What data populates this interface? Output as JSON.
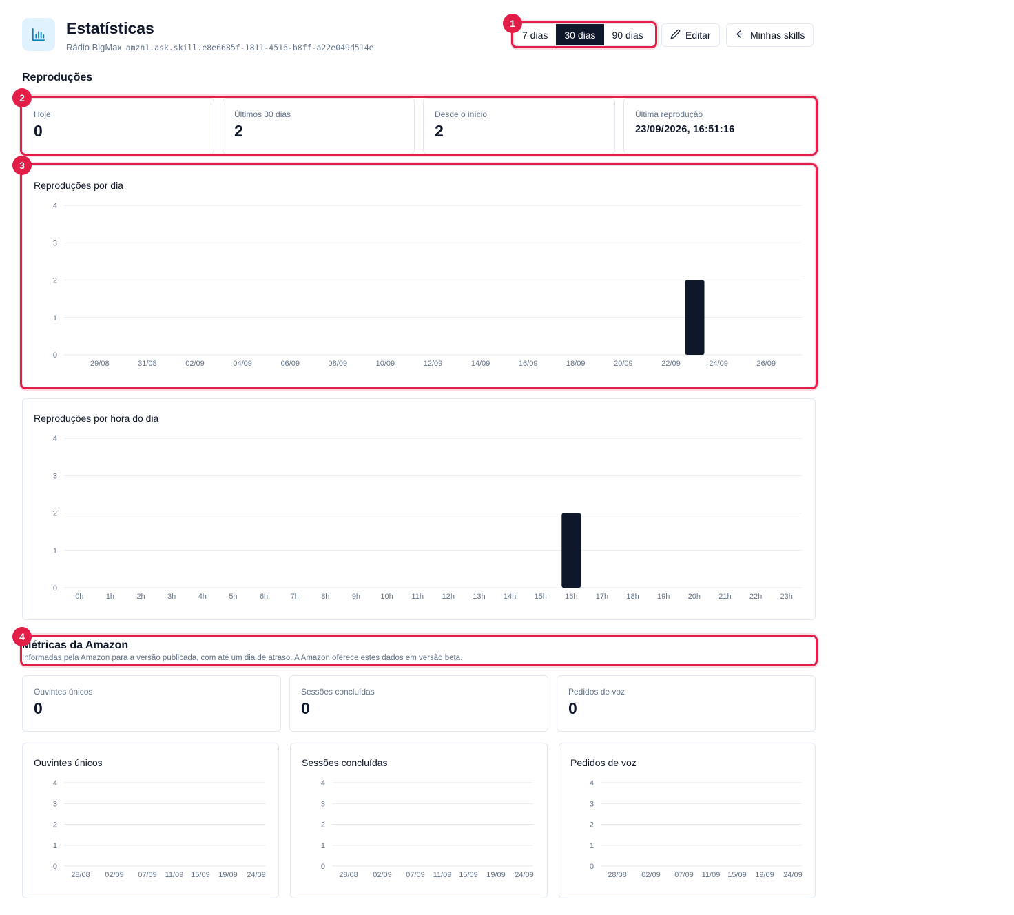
{
  "header": {
    "title": "Estatísticas",
    "skill_name": "Rádio BigMax",
    "skill_id": "amzn1.ask.skill.e8e6685f-1811-4516-b8ff-a22e049d514e",
    "ranges": [
      "7 dias",
      "30 dias",
      "90 dias"
    ],
    "active_range": "30 dias",
    "edit_label": "Editar",
    "back_label": "Minhas skills",
    "logo_icon": "bar-chart-icon"
  },
  "reproducoes": {
    "title": "Reproduções",
    "stats": [
      {
        "label": "Hoje",
        "value": "0"
      },
      {
        "label": "Últimos 30 dias",
        "value": "2"
      },
      {
        "label": "Desde o início",
        "value": "2"
      },
      {
        "label": "Última reprodução",
        "value": "23/09/2026, 16:51:16"
      }
    ]
  },
  "amazon": {
    "title": "Métricas da Amazon",
    "description": "Informadas pela Amazon para a versão publicada, com até um dia de atraso. A Amazon oferece estes dados em versão beta.",
    "stats": [
      {
        "label": "Ouvintes únicos",
        "value": "0"
      },
      {
        "label": "Sessões concluídas",
        "value": "0"
      },
      {
        "label": "Pedidos de voz",
        "value": "0"
      }
    ]
  },
  "annotations": [
    "1",
    "2",
    "3",
    "4"
  ],
  "colors": {
    "bar": "#0f172a",
    "highlight": "#e11d48",
    "grid": "#e5e7eb"
  },
  "chart_data": [
    {
      "type": "bar",
      "title": "Reproduções por dia",
      "x_ticks": [
        "29/08",
        "31/08",
        "02/09",
        "04/09",
        "06/09",
        "08/09",
        "10/09",
        "12/09",
        "14/09",
        "16/09",
        "18/09",
        "20/09",
        "22/09",
        "24/09",
        "26/09"
      ],
      "categories": [
        "28/08",
        "29/08",
        "30/08",
        "31/08",
        "01/09",
        "02/09",
        "03/09",
        "04/09",
        "05/09",
        "06/09",
        "07/09",
        "08/09",
        "09/09",
        "10/09",
        "11/09",
        "12/09",
        "13/09",
        "14/09",
        "15/09",
        "16/09",
        "17/09",
        "18/09",
        "19/09",
        "20/09",
        "21/09",
        "22/09",
        "23/09",
        "24/09",
        "25/09",
        "26/09",
        "27/09"
      ],
      "values": [
        0,
        0,
        0,
        0,
        0,
        0,
        0,
        0,
        0,
        0,
        0,
        0,
        0,
        0,
        0,
        0,
        0,
        0,
        0,
        0,
        0,
        0,
        0,
        0,
        0,
        0,
        2,
        0,
        0,
        0,
        0
      ],
      "yticks": [
        "0",
        "1",
        "2",
        "3",
        "4"
      ],
      "ylim": [
        0,
        4
      ],
      "grid": true
    },
    {
      "type": "bar",
      "title": "Reproduções por hora do dia",
      "categories": [
        "0h",
        "1h",
        "2h",
        "3h",
        "4h",
        "5h",
        "6h",
        "7h",
        "8h",
        "9h",
        "10h",
        "11h",
        "12h",
        "13h",
        "14h",
        "15h",
        "16h",
        "17h",
        "18h",
        "19h",
        "20h",
        "21h",
        "22h",
        "23h"
      ],
      "values": [
        0,
        0,
        0,
        0,
        0,
        0,
        0,
        0,
        0,
        0,
        0,
        0,
        0,
        0,
        0,
        0,
        2,
        0,
        0,
        0,
        0,
        0,
        0,
        0
      ],
      "yticks": [
        "0",
        "1",
        "2",
        "3",
        "4"
      ],
      "ylim": [
        0,
        4
      ],
      "grid": true
    },
    {
      "type": "line",
      "title": "Ouvintes únicos",
      "x_ticks": [
        "28/08",
        "02/09",
        "07/09",
        "11/09",
        "15/09",
        "19/09",
        "24/09"
      ],
      "values": [],
      "yticks": [
        "0",
        "1",
        "2",
        "3",
        "4"
      ],
      "ylim": [
        0,
        4
      ],
      "grid": true
    },
    {
      "type": "line",
      "title": "Sessões concluídas",
      "x_ticks": [
        "28/08",
        "02/09",
        "07/09",
        "11/09",
        "15/09",
        "19/09",
        "24/09"
      ],
      "values": [],
      "yticks": [
        "0",
        "1",
        "2",
        "3",
        "4"
      ],
      "ylim": [
        0,
        4
      ],
      "grid": true
    },
    {
      "type": "line",
      "title": "Pedidos de voz",
      "x_ticks": [
        "28/08",
        "02/09",
        "07/09",
        "11/09",
        "15/09",
        "19/09",
        "24/09"
      ],
      "values": [],
      "yticks": [
        "0",
        "1",
        "2",
        "3",
        "4"
      ],
      "ylim": [
        0,
        4
      ],
      "grid": true
    }
  ]
}
